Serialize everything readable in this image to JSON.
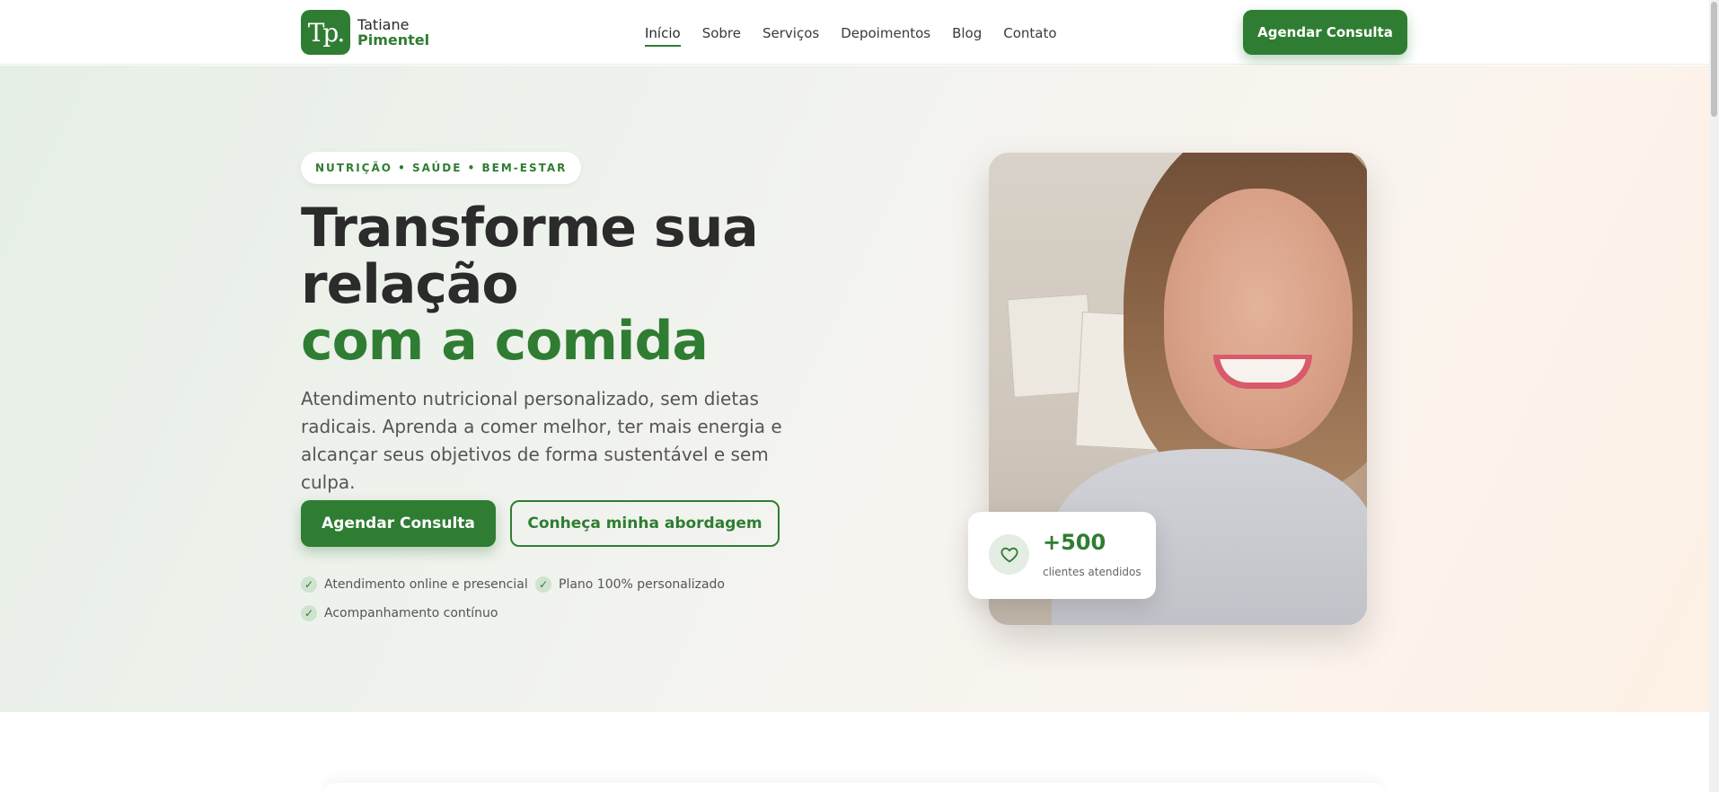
{
  "brand": {
    "first_name": "Tatiane",
    "last_name": "Pimentel",
    "monogram": "Tp."
  },
  "nav": {
    "items": [
      {
        "label": "Início",
        "active": true
      },
      {
        "label": "Sobre"
      },
      {
        "label": "Serviços"
      },
      {
        "label": "Depoimentos"
      },
      {
        "label": "Blog"
      },
      {
        "label": "Contato"
      }
    ],
    "cta_label": "Agendar Consulta"
  },
  "hero": {
    "eyebrow": "NUTRIÇÃO • SAÚDE • BEM-ESTAR",
    "headline_line1": "Transforme sua",
    "headline_line2": "relação",
    "headline_line3": "com a comida",
    "lead": "Atendimento nutricional personalizado, sem dietas radicais. Aprenda a comer melhor, ter mais energia e alcançar seus objetivos de forma sustentável e sem culpa.",
    "primary_button": "Agendar Consulta",
    "secondary_button": "Conheça minha abordagem",
    "features": [
      "Atendimento online e presencial",
      "Plano 100% personalizado",
      "Acompanhamento contínuo"
    ],
    "stat": {
      "value": "+500",
      "label": "clientes atendidos",
      "icon": "heart-icon"
    }
  },
  "colors": {
    "accent": "#2f7d32",
    "text": "#2b2b2b"
  }
}
